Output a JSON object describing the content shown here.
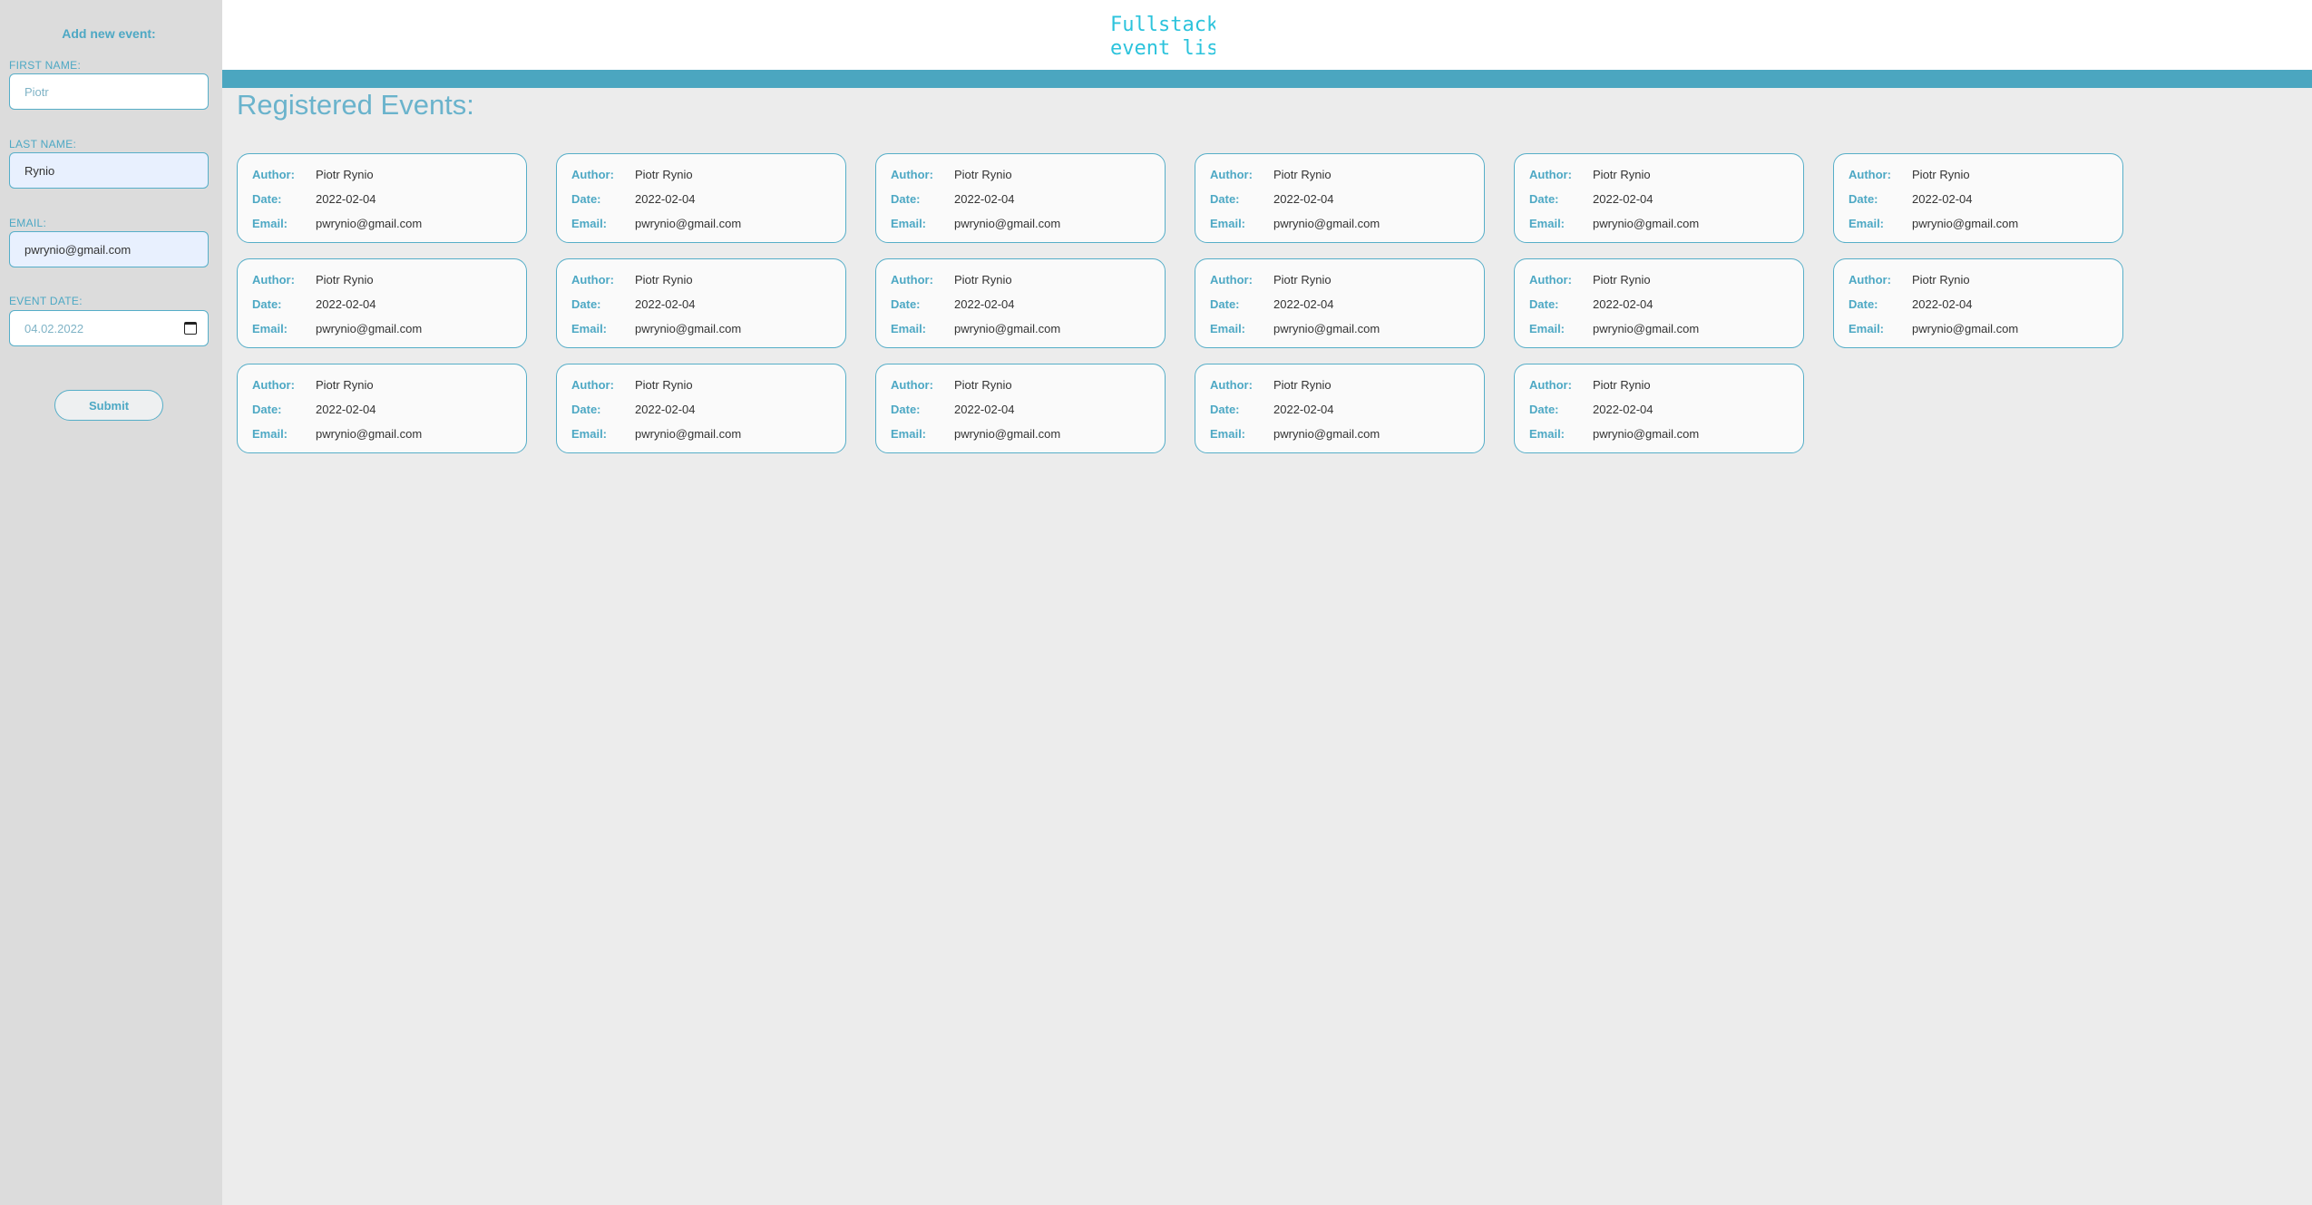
{
  "sidebar": {
    "title": "Add new event:",
    "first_name": {
      "label": "FIRST NAME:",
      "placeholder": "Piotr"
    },
    "last_name": {
      "label": "LAST NAME:",
      "value": "Rynio"
    },
    "email": {
      "label": "EMAIL:",
      "value": "pwrynio@gmail.com"
    },
    "event_date": {
      "label": "EVENT DATE:",
      "value": "04.02.2022"
    },
    "submit_label": "Submit"
  },
  "header": {
    "logo_text_line1": "Fullstack",
    "logo_text_line2": "event list"
  },
  "main": {
    "title": "Registered Events:",
    "labels": {
      "author": "Author:",
      "date": "Date:",
      "email": "Email:"
    },
    "events": [
      {
        "author": "Piotr Rynio",
        "date": "2022-02-04",
        "email": "pwrynio@gmail.com"
      },
      {
        "author": "Piotr Rynio",
        "date": "2022-02-04",
        "email": "pwrynio@gmail.com"
      },
      {
        "author": "Piotr Rynio",
        "date": "2022-02-04",
        "email": "pwrynio@gmail.com"
      },
      {
        "author": "Piotr Rynio",
        "date": "2022-02-04",
        "email": "pwrynio@gmail.com"
      },
      {
        "author": "Piotr Rynio",
        "date": "2022-02-04",
        "email": "pwrynio@gmail.com"
      },
      {
        "author": "Piotr Rynio",
        "date": "2022-02-04",
        "email": "pwrynio@gmail.com"
      },
      {
        "author": "Piotr Rynio",
        "date": "2022-02-04",
        "email": "pwrynio@gmail.com"
      },
      {
        "author": "Piotr Rynio",
        "date": "2022-02-04",
        "email": "pwrynio@gmail.com"
      },
      {
        "author": "Piotr Rynio",
        "date": "2022-02-04",
        "email": "pwrynio@gmail.com"
      },
      {
        "author": "Piotr Rynio",
        "date": "2022-02-04",
        "email": "pwrynio@gmail.com"
      },
      {
        "author": "Piotr Rynio",
        "date": "2022-02-04",
        "email": "pwrynio@gmail.com"
      },
      {
        "author": "Piotr Rynio",
        "date": "2022-02-04",
        "email": "pwrynio@gmail.com"
      },
      {
        "author": "Piotr Rynio",
        "date": "2022-02-04",
        "email": "pwrynio@gmail.com"
      },
      {
        "author": "Piotr Rynio",
        "date": "2022-02-04",
        "email": "pwrynio@gmail.com"
      },
      {
        "author": "Piotr Rynio",
        "date": "2022-02-04",
        "email": "pwrynio@gmail.com"
      },
      {
        "author": "Piotr Rynio",
        "date": "2022-02-04",
        "email": "pwrynio@gmail.com"
      },
      {
        "author": "Piotr Rynio",
        "date": "2022-02-04",
        "email": "pwrynio@gmail.com"
      }
    ]
  },
  "colors": {
    "accent": "#4ba6c0",
    "sidebar_bg": "#dcdcdc",
    "page_bg": "#ececec",
    "logo": "#2cc3dc"
  },
  "icons": {
    "date_picker": "calendar-icon"
  }
}
